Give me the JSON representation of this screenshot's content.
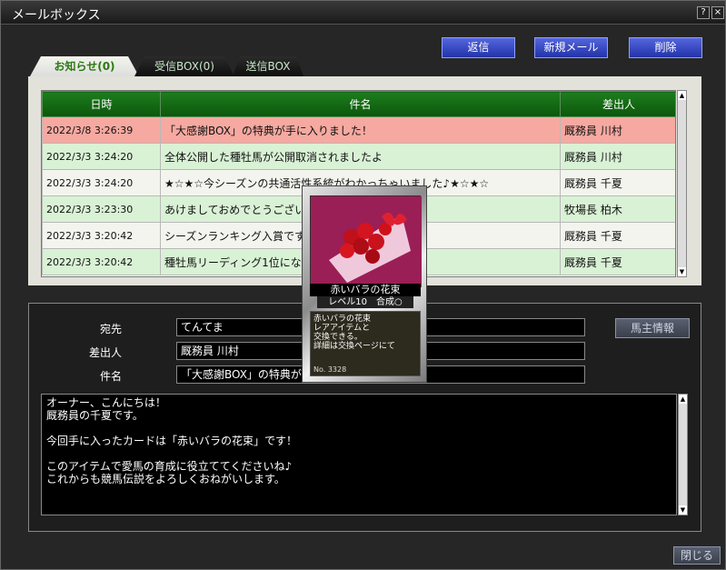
{
  "window": {
    "title": "メールボックス",
    "help_label": "?",
    "close_label": "×"
  },
  "toolbar": {
    "reply_label": "返信",
    "new_mail_label": "新規メール",
    "delete_label": "削除"
  },
  "tabs": [
    {
      "label": "お知らせ(0)",
      "active": true
    },
    {
      "label": "受信BOX(0)",
      "active": false
    },
    {
      "label": "送信BOX",
      "active": false
    }
  ],
  "table": {
    "columns": [
      "日時",
      "件名",
      "差出人"
    ],
    "rows": [
      {
        "date": "2022/3/8 3:26:39",
        "subject": "「大感謝BOX」の特典が手に入りました！",
        "sender": "厩務員 川村",
        "selected": true
      },
      {
        "date": "2022/3/3 3:24:20",
        "subject": "全体公開した種牡馬が公開取消されましたよ",
        "sender": "厩務員 川村"
      },
      {
        "date": "2022/3/3 3:24:20",
        "subject": "★☆★☆今シーズンの共通活性系統がわかっちゃいました♪★☆★☆",
        "sender": "厩務員 千夏"
      },
      {
        "date": "2022/3/3 3:23:30",
        "subject": "あけましておめでとうございます",
        "sender": "牧場長 柏木"
      },
      {
        "date": "2022/3/3 3:20:42",
        "subject": "シーズンランキング入賞ですね",
        "sender": "厩務員 千夏"
      },
      {
        "date": "2022/3/3 3:20:42",
        "subject": "種牡馬リーディング1位になりま",
        "sender": "厩務員 千夏"
      }
    ]
  },
  "detail": {
    "to_label": "宛先",
    "to_value": "てんてま",
    "from_label": "差出人",
    "from_value": "厩務員 川村",
    "subject_label": "件名",
    "subject_value": "「大感謝BOX」の特典が手に入りました！",
    "owner_info_label": "馬主情報",
    "body": [
      "オーナー、こんにちは！",
      "厩務員の千夏です。",
      "",
      "今回手に入ったカードは「赤いバラの花束」です！",
      "",
      "このアイテムで愛馬の育成に役立ててくださいね♪",
      "これからも競馬伝説をよろしくおねがいします。"
    ]
  },
  "card": {
    "name": "赤いバラの花束",
    "level": "レベル10　合成○",
    "desc": [
      "赤いバラの花束",
      "レアアイテムと",
      "交換できる。",
      "詳細は交換ページにて"
    ],
    "number": "No. 3328"
  },
  "footer": {
    "close_label": "閉じる"
  }
}
